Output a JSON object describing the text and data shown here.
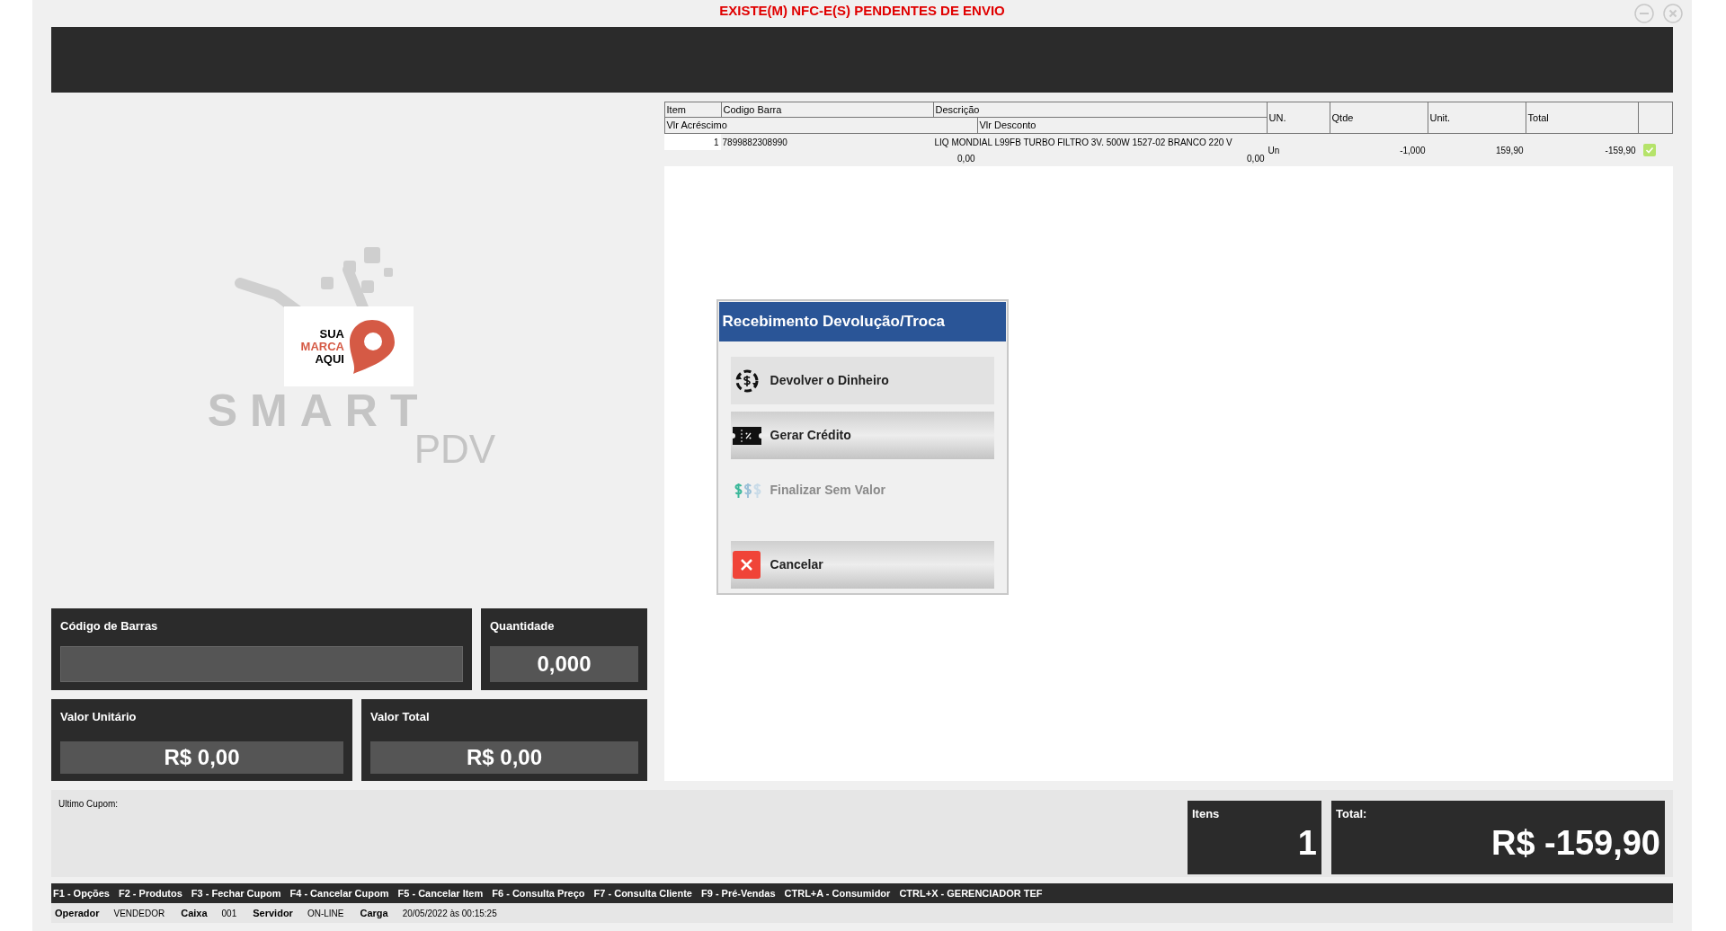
{
  "window": {
    "title": "EXISTE(M) NFC-E(S) PENDENTES DE ENVIO"
  },
  "logo": {
    "brand_lines": [
      "SUA",
      "MARCA",
      "AQUI"
    ],
    "product": "SMART",
    "subtitle": "PDV"
  },
  "table": {
    "header_top": [
      "Item",
      "Codigo Barra",
      "Descrição"
    ],
    "header_bottom": [
      "Vlr Acréscimo",
      "Vlr Desconto"
    ],
    "columns": [
      "UN.",
      "Qtde",
      "Unit.",
      "Total"
    ],
    "rows": [
      {
        "item": "1",
        "barcode": "7899882308990",
        "description": "LIQ MONDIAL L99FB TURBO FILTRO 3V. 500W 1527-02 BRANCO 220 V",
        "surcharge": "0,00",
        "discount": "0,00",
        "unit": "Un",
        "qty": "-1,000",
        "price": "159,90",
        "total": "-159,90",
        "checked": true
      }
    ]
  },
  "fields": {
    "barcode": {
      "label": "Código de Barras"
    },
    "quantity": {
      "label": "Quantidade",
      "value": "0,000"
    },
    "unit_value": {
      "label": "Valor Unitário",
      "value": "R$ 0,00"
    },
    "total_value": {
      "label": "Valor Total",
      "value": "R$ 0,00"
    }
  },
  "dialog": {
    "title": "Recebimento Devolução/Troca",
    "options": [
      {
        "kind": "refund",
        "label": "Devolver o Dinheiro",
        "focused": true,
        "disabled": false
      },
      {
        "kind": "credit",
        "label": "Gerar Crédito",
        "focused": false,
        "disabled": false
      },
      {
        "kind": "novalue",
        "label": "Finalizar Sem Valor",
        "focused": false,
        "disabled": true
      },
      {
        "kind": "cancel",
        "label": "Cancelar",
        "focused": false,
        "disabled": false
      }
    ]
  },
  "last_coupon": {
    "label": "Ultimo Cupom:"
  },
  "items": {
    "label": "Itens",
    "value": "1"
  },
  "total": {
    "label": "Total:",
    "value": "R$ -159,90"
  },
  "shortcuts": [
    "F1 - Opções",
    "F2 - Produtos",
    "F3 - Fechar Cupom",
    "F4 - Cancelar Cupom",
    "F5 - Cancelar Item",
    "F6 - Consulta Preço",
    "F7 - Consulta Cliente",
    "F9 - Pré-Vendas",
    "CTRL+A - Consumidor",
    "CTRL+X - GERENCIADOR TEF"
  ],
  "status_bar": [
    {
      "label": "Operador",
      "value": "VENDEDOR"
    },
    {
      "label": "Caixa",
      "value": "001"
    },
    {
      "label": "Servidor",
      "value": "ON-LINE"
    },
    {
      "label": "Carga",
      "value": "20/05/2022 às 00:15:25"
    }
  ]
}
